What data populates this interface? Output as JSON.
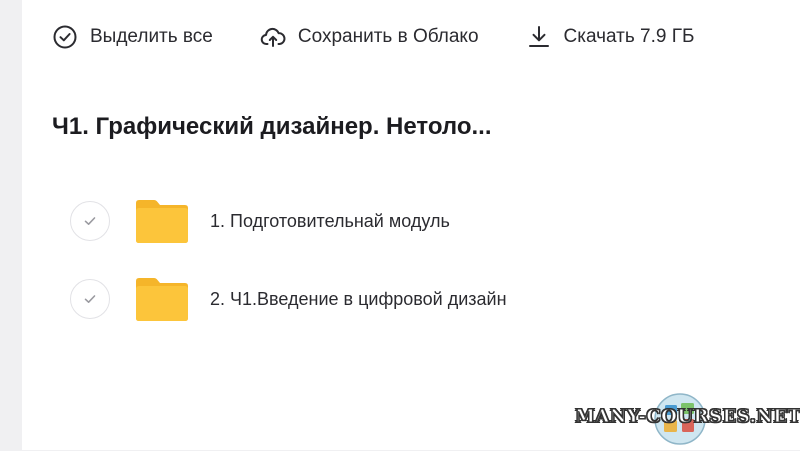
{
  "toolbar": {
    "select_all": {
      "label": "Выделить все",
      "icon": "check-circle-icon"
    },
    "save_to_cloud": {
      "label": "Сохранить в Облако",
      "icon": "cloud-upload-icon"
    },
    "download": {
      "label": "Скачать 7.9 ГБ",
      "icon": "download-icon"
    }
  },
  "folder": {
    "title": "Ч1. Графический дизайнер. Нетоло..."
  },
  "items": [
    {
      "name": "1. Подготовительнай модуль",
      "type": "folder",
      "icon": "folder-icon"
    },
    {
      "name": "2. Ч1.Введение в цифровой дизайн",
      "type": "folder",
      "icon": "folder-icon"
    }
  ],
  "watermark": {
    "text": "MANY-COURSES.NET"
  },
  "colors": {
    "folder": "#fbc531",
    "folder_dark": "#f5b52a",
    "background": "#f0f0f2",
    "panel": "#ffffff"
  }
}
